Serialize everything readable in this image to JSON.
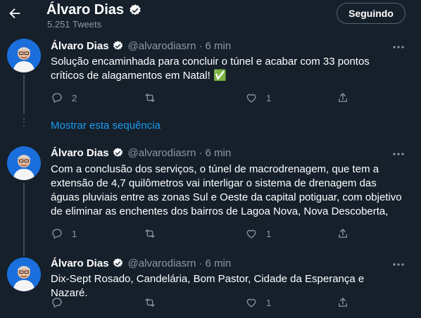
{
  "header": {
    "title": "Álvaro Dias",
    "tweet_count": "5.251 Tweets",
    "follow_label": "Seguindo"
  },
  "show_thread": "Mostrar esta sequência",
  "tweets": [
    {
      "name": "Álvaro Dias",
      "handle": "@alvarodiasrn",
      "separator": "·",
      "time": "6 min",
      "text": "Solução encaminhada para concluir o túnel e acabar com 33 pontos críticos de alagamentos em Natal! ✅",
      "replies": "2",
      "retweets": "",
      "likes": "1"
    },
    {
      "name": "Álvaro Dias",
      "handle": "@alvarodiasrn",
      "separator": "·",
      "time": "6 min",
      "text": "Com a conclusão dos serviços, o túnel de macrodrenagem, que tem a extensão de 4,7 quilômetros vai interligar o sistema de drenagem das águas pluviais entre as zonas Sul e Oeste da capital potiguar, com objetivo de eliminar as enchentes dos bairros de Lagoa Nova, Nova Descoberta,",
      "replies": "1",
      "retweets": "",
      "likes": "1"
    },
    {
      "name": "Álvaro Dias",
      "handle": "@alvarodiasrn",
      "separator": "·",
      "time": "6 min",
      "text": "Dix-Sept Rosado, Candelária, Bom Pastor, Cidade da Esperança e Nazaré.",
      "replies": "",
      "retweets": "",
      "likes": "1"
    }
  ],
  "colors": {
    "background": "#15202b",
    "muted": "#8b98a5",
    "accent": "#1d9bf0",
    "check": "#4caf50"
  },
  "icons": [
    "back-arrow-icon",
    "verified-badge-icon",
    "more-icon",
    "reply-icon",
    "retweet-icon",
    "like-icon",
    "share-icon"
  ]
}
